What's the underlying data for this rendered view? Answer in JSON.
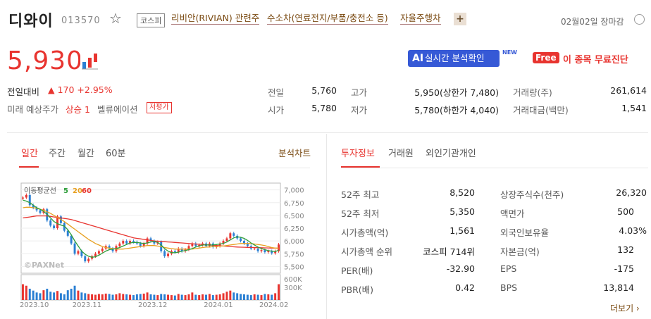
{
  "header": {
    "name": "디와이",
    "code": "013570",
    "market": "코스피",
    "themes": [
      "리비안(RIVIAN) 관련주",
      "수소차(연료전지/부품/충전소 등)",
      "자율주행차"
    ],
    "plus": "+",
    "date_status": "02월02일 장마감"
  },
  "price": {
    "current": "5,930",
    "change_label": "전일대비",
    "change": "▲ 170 +2.95%",
    "future_label": "미래 예상주가",
    "future_value": "상승 1",
    "valuation_label": "벨류에이션",
    "valuation_badge": "저평가"
  },
  "promo": {
    "ai_prefix": "AI",
    "ai_label": "실시간 분석확인",
    "new_tag": "NEW",
    "free_badge": "Free",
    "free_text": "이 종목 무료진단"
  },
  "quote": {
    "prev_label": "전일",
    "prev": "5,760",
    "open_label": "시가",
    "open": "5,780",
    "high_label": "고가",
    "high": "5,950(상한가 7,480)",
    "low_label": "저가",
    "low": "5,780(하한가 4,040)",
    "vol_label": "거래량(주)",
    "vol": "261,614",
    "amt_label": "거래대금(백만)",
    "amt": "1,541"
  },
  "chart_tabs": [
    "일간",
    "주간",
    "월간",
    "60분"
  ],
  "analysis_link": "분석차트",
  "info_tabs": [
    "투자정보",
    "거래원",
    "외인기관개인"
  ],
  "invest_info": {
    "left": [
      {
        "label": "52주 최고",
        "value": "8,520"
      },
      {
        "label": "52주 최저",
        "value": "5,350"
      },
      {
        "label": "시가총액(억)",
        "value": "1,561"
      },
      {
        "label": "시가총액 순위",
        "value": "코스피 714위"
      },
      {
        "label": "PER(배)",
        "value": "-32.90"
      },
      {
        "label": "PBR(배)",
        "value": "0.42"
      }
    ],
    "right": [
      {
        "label": "상장주식수(천주)",
        "value": "26,320"
      },
      {
        "label": "액면가",
        "value": "500"
      },
      {
        "label": "외국인보유율",
        "value": "4.03%"
      },
      {
        "label": "자본금(억)",
        "value": "132"
      },
      {
        "label": "EPS",
        "value": "-175"
      },
      {
        "label": "BPS",
        "value": "13,814"
      }
    ]
  },
  "more": "더보기 ›",
  "chart_data": {
    "type": "line",
    "legend_label": "이동평균선",
    "ma_labels": [
      "5",
      "20",
      "60"
    ],
    "ma_colors": [
      "#2e9e3a",
      "#e8a020",
      "#e8342f"
    ],
    "watermark": "©PAXNet",
    "y_ticks": [
      "7,000",
      "6,750",
      "6,500",
      "6,250",
      "6,000",
      "5,750",
      "5,500"
    ],
    "y_range": [
      5450,
      7050
    ],
    "vol_ticks": [
      "600K",
      "300K"
    ],
    "x_ticks": [
      "2023.10",
      "2023.11",
      "2023.12",
      "2024.01",
      "2024.02"
    ],
    "closes": [
      6850,
      6900,
      6700,
      6650,
      6600,
      6550,
      6620,
      6400,
      6300,
      6250,
      6480,
      6350,
      6200,
      6100,
      5950,
      5750,
      5800,
      5700,
      5600,
      5650,
      5700,
      5750,
      5800,
      5850,
      5900,
      5850,
      5800,
      5900,
      5950,
      6000,
      5950,
      6000,
      5980,
      5950,
      5900,
      5950,
      6050,
      6000,
      5950,
      5980,
      5800,
      5700,
      5750,
      5800,
      5780,
      5850,
      5800,
      5830,
      5900,
      5950,
      5900,
      5920,
      5950,
      5900,
      5950,
      5880,
      5900,
      5950,
      6000,
      6050,
      6150,
      6100,
      6050,
      6000,
      5950,
      5900,
      5850,
      5850,
      5800,
      5820,
      5780,
      5800,
      5760,
      5800,
      5930
    ],
    "ma5": [
      6800,
      6780,
      6750,
      6700,
      6650,
      6620,
      6580,
      6520,
      6450,
      6380,
      6340,
      6310,
      6290,
      6220,
      6120,
      6000,
      5900,
      5800,
      5740,
      5700,
      5680,
      5690,
      5720,
      5760,
      5800,
      5830,
      5840,
      5850,
      5870,
      5900,
      5930,
      5960,
      5970,
      5970,
      5960,
      5950,
      5960,
      5980,
      5990,
      5970,
      5920,
      5850,
      5800,
      5770,
      5770,
      5780,
      5800,
      5810,
      5830,
      5850,
      5880,
      5900,
      5920,
      5920,
      5920,
      5920,
      5930,
      5940,
      5950,
      5980,
      6020,
      6060,
      6080,
      6070,
      6050,
      6010,
      5960,
      5920,
      5880,
      5850,
      5830,
      5810,
      5800,
      5790,
      5820
    ],
    "ma20": [
      6650,
      6660,
      6660,
      6650,
      6640,
      6620,
      6600,
      6570,
      6540,
      6500,
      6460,
      6420,
      6380,
      6330,
      6280,
      6230,
      6180,
      6130,
      6080,
      6030,
      5990,
      5950,
      5920,
      5890,
      5870,
      5860,
      5850,
      5840,
      5840,
      5840,
      5850,
      5860,
      5870,
      5880,
      5890,
      5900,
      5910,
      5910,
      5910,
      5900,
      5890,
      5870,
      5860,
      5850,
      5840,
      5840,
      5840,
      5840,
      5840,
      5840,
      5850,
      5860,
      5870,
      5880,
      5880,
      5890,
      5890,
      5900,
      5900,
      5910,
      5920,
      5930,
      5940,
      5950,
      5950,
      5950,
      5950,
      5940,
      5930,
      5920,
      5910,
      5890,
      5870,
      5860,
      5860
    ],
    "ma60": [
      6450,
      6460,
      6470,
      6480,
      6490,
      6490,
      6490,
      6490,
      6480,
      6470,
      6460,
      6450,
      6440,
      6430,
      6420,
      6400,
      6380,
      6360,
      6340,
      6320,
      6300,
      6280,
      6260,
      6240,
      6220,
      6200,
      6180,
      6160,
      6140,
      6120,
      6100,
      6080,
      6060,
      6050,
      6040,
      6030,
      6020,
      6010,
      6000,
      5995,
      5990,
      5985,
      5980,
      5975,
      5970,
      5965,
      5960,
      5955,
      5950,
      5945,
      5940,
      5935,
      5930,
      5925,
      5920,
      5915,
      5910,
      5905,
      5900,
      5895,
      5890,
      5885,
      5880,
      5878,
      5876,
      5874,
      5872,
      5870,
      5868,
      5866,
      5864,
      5862,
      5860,
      5858,
      5856
    ],
    "volumes": [
      420,
      380,
      300,
      250,
      200,
      180,
      260,
      300,
      220,
      200,
      240,
      180,
      150,
      260,
      300,
      380,
      250,
      200,
      180,
      160,
      150,
      140,
      160,
      150,
      170,
      160,
      140,
      150,
      180,
      160,
      150,
      140,
      130,
      150,
      160,
      170,
      200,
      150,
      140,
      130,
      160,
      150,
      140,
      130,
      120,
      160,
      140,
      130,
      150,
      200,
      140,
      130,
      150,
      140,
      160,
      130,
      140,
      150,
      180,
      220,
      250,
      200,
      180,
      160,
      150,
      140,
      130,
      150,
      140,
      130,
      160,
      150,
      140,
      180,
      420
    ]
  }
}
